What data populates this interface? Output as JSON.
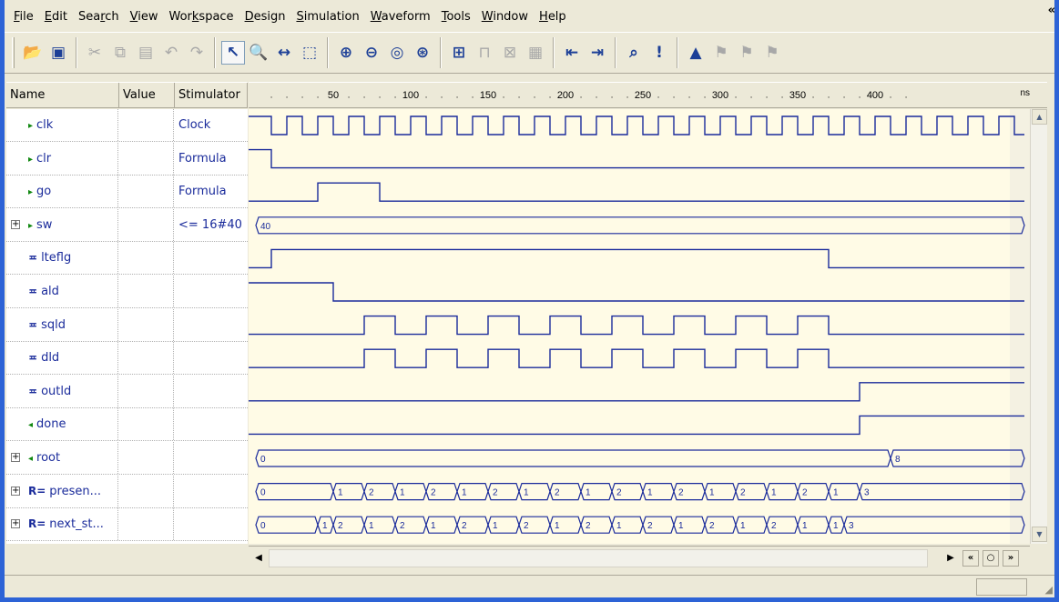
{
  "menu": {
    "items": [
      {
        "pre": "",
        "ul": "F",
        "post": "ile"
      },
      {
        "pre": "",
        "ul": "E",
        "post": "dit"
      },
      {
        "pre": "Sea",
        "ul": "r",
        "post": "ch"
      },
      {
        "pre": "",
        "ul": "V",
        "post": "iew"
      },
      {
        "pre": "Wor",
        "ul": "k",
        "post": "space"
      },
      {
        "pre": "",
        "ul": "D",
        "post": "esign"
      },
      {
        "pre": "",
        "ul": "S",
        "post": "imulation"
      },
      {
        "pre": "",
        "ul": "W",
        "post": "aveform"
      },
      {
        "pre": "",
        "ul": "T",
        "post": "ools"
      },
      {
        "pre": "",
        "ul": "W",
        "post": "indow"
      },
      {
        "pre": "",
        "ul": "H",
        "post": "elp"
      }
    ],
    "chevron": "«"
  },
  "toolbar": {
    "groups": [
      [
        {
          "icon": "open-folder-icon",
          "glyph": "📂",
          "enabled": true
        },
        {
          "icon": "save-icon",
          "glyph": "▣",
          "enabled": true
        }
      ],
      [
        {
          "icon": "cut-icon",
          "glyph": "✂",
          "enabled": false
        },
        {
          "icon": "copy-icon",
          "glyph": "⧉",
          "enabled": false
        },
        {
          "icon": "paste-icon",
          "glyph": "▤",
          "enabled": false
        },
        {
          "icon": "undo-icon",
          "glyph": "↶",
          "enabled": false
        },
        {
          "icon": "redo-icon",
          "glyph": "↷",
          "enabled": false
        }
      ],
      [
        {
          "icon": "select-pointer-icon",
          "glyph": "↖",
          "enabled": true,
          "pressed": true
        },
        {
          "icon": "zoom-tool-icon",
          "glyph": "🔍",
          "enabled": true
        },
        {
          "icon": "measure-icon",
          "glyph": "↔",
          "enabled": true
        },
        {
          "icon": "select-region-icon",
          "glyph": "⬚",
          "enabled": true
        }
      ],
      [
        {
          "icon": "zoom-in-icon",
          "glyph": "⊕",
          "enabled": true
        },
        {
          "icon": "zoom-out-icon",
          "glyph": "⊖",
          "enabled": true
        },
        {
          "icon": "zoom-fit-icon",
          "glyph": "◎",
          "enabled": true
        },
        {
          "icon": "zoom-range-icon",
          "glyph": "⊛",
          "enabled": true
        }
      ],
      [
        {
          "icon": "add-signal-icon",
          "glyph": "⊞",
          "enabled": true
        },
        {
          "icon": "edit-stimulus-icon",
          "glyph": "⊓",
          "enabled": false
        },
        {
          "icon": "bus-icon",
          "glyph": "⊠",
          "enabled": false
        },
        {
          "icon": "properties-icon",
          "glyph": "▦",
          "enabled": false
        }
      ],
      [
        {
          "icon": "prev-edge-icon",
          "glyph": "⇤",
          "enabled": true
        },
        {
          "icon": "next-edge-icon",
          "glyph": "⇥",
          "enabled": true
        }
      ],
      [
        {
          "icon": "find-icon",
          "glyph": "⌕",
          "enabled": true
        },
        {
          "icon": "find-next-icon",
          "glyph": "!",
          "enabled": true
        }
      ],
      [
        {
          "icon": "bookmark-icon",
          "glyph": "▲",
          "enabled": true
        },
        {
          "icon": "bookmark-prev-icon",
          "glyph": "⚑",
          "enabled": false
        },
        {
          "icon": "bookmark-next-icon",
          "glyph": "⚑",
          "enabled": false
        },
        {
          "icon": "bookmark-clear-icon",
          "glyph": "⚑",
          "enabled": false
        }
      ]
    ]
  },
  "columns": {
    "name": "Name",
    "value": "Value",
    "stimulator": "Stimulator"
  },
  "ruler": {
    "labels": [
      "50",
      "100",
      "150",
      "200",
      "250",
      "300",
      "350",
      "400"
    ],
    "unit": "ns"
  },
  "signals": [
    {
      "name": "clk",
      "type": "input",
      "expandable": false,
      "stimulator": "Clock"
    },
    {
      "name": "clr",
      "type": "input",
      "expandable": false,
      "stimulator": "Formula"
    },
    {
      "name": "go",
      "type": "input",
      "expandable": false,
      "stimulator": "Formula"
    },
    {
      "name": "sw",
      "type": "input",
      "expandable": true,
      "stimulator": "<= 16#40",
      "bus_values": [
        "40"
      ]
    },
    {
      "name": "lteflg",
      "type": "internal",
      "expandable": false,
      "stimulator": ""
    },
    {
      "name": "ald",
      "type": "internal",
      "expandable": false,
      "stimulator": ""
    },
    {
      "name": "sqld",
      "type": "internal",
      "expandable": false,
      "stimulator": ""
    },
    {
      "name": "dld",
      "type": "internal",
      "expandable": false,
      "stimulator": ""
    },
    {
      "name": "outld",
      "type": "internal",
      "expandable": false,
      "stimulator": ""
    },
    {
      "name": "done",
      "type": "output",
      "expandable": false,
      "stimulator": ""
    },
    {
      "name": "root",
      "type": "output",
      "expandable": true,
      "stimulator": "",
      "bus_values": [
        "0",
        "8"
      ]
    },
    {
      "name": "presen...",
      "type": "state",
      "expandable": true,
      "stimulator": "",
      "bus_values": [
        "0",
        "1",
        "2",
        "1",
        "2",
        "1",
        "2",
        "1",
        "2",
        "1",
        "2",
        "1",
        "2",
        "1",
        "2",
        "1",
        "2",
        "1",
        "3"
      ]
    },
    {
      "name": "next_st...",
      "type": "state",
      "expandable": true,
      "stimulator": "",
      "bus_values": [
        "0",
        "1",
        "2",
        "1",
        "2",
        "1",
        "2",
        "1",
        "2",
        "1",
        "2",
        "1",
        "2",
        "1",
        "2",
        "1",
        "2",
        "1",
        "3"
      ]
    }
  ],
  "colors": {
    "wave": "#1a2b9b",
    "wave_bg": "#fffbe6",
    "window_border": "#2d63d6",
    "signal_name": "#1a2b9b"
  }
}
